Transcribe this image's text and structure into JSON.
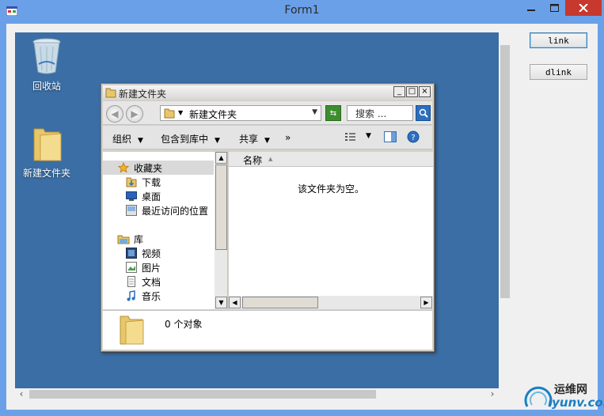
{
  "window": {
    "title": "Form1"
  },
  "buttons": {
    "link": "link",
    "dlink": "dlink"
  },
  "desktop": {
    "icons": [
      {
        "label": "回收站",
        "icon": "recycle-bin-icon"
      },
      {
        "label": "新建文件夹",
        "icon": "folder-icon"
      }
    ]
  },
  "explorer": {
    "title": "新建文件夹",
    "address": "新建文件夹",
    "search_placeholder": "搜索 ...",
    "toolbar": [
      "组织",
      "包含到库中",
      "共享",
      "»"
    ],
    "nav": {
      "favorites": "收藏夹",
      "favorites_items": [
        "下载",
        "桌面",
        "最近访问的位置"
      ],
      "libraries": "库",
      "libraries_items": [
        "视频",
        "图片",
        "文档",
        "音乐"
      ]
    },
    "list": {
      "column_name": "名称",
      "empty_text": "该文件夹为空。"
    },
    "details": {
      "count_text": "0 个对象"
    }
  },
  "watermark": {
    "top": "运维网",
    "bottom": "iyunv.com"
  }
}
